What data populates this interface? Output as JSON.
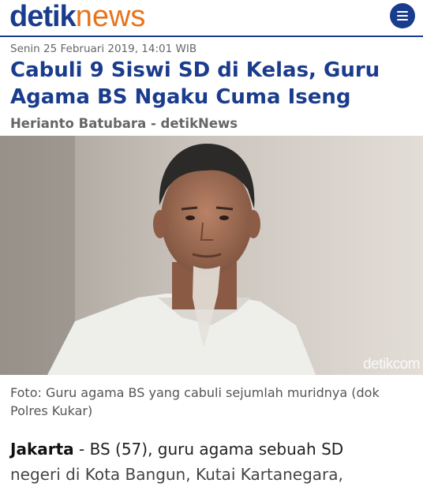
{
  "header": {
    "logo_part1": "detik",
    "logo_part2": "news",
    "menu_icon": "hamburger-menu-icon"
  },
  "article": {
    "date": "Senin 25 Februari 2019, 14:01 WIB",
    "title": "Cabuli 9 Siswi SD di Kelas, Guru Agama BS Ngaku Cuma Iseng",
    "author": "Herianto Batubara - detikNews",
    "photo_watermark": "detikcom",
    "caption": "Foto: Guru agama BS yang cabuli sejumlah muridnya (dok Polres Kukar)",
    "lead_location": "Jakarta",
    "lead_text": " - BS (57), guru agama sebuah SD",
    "lead_text_line2": "negeri di Kota Bangun, Kutai Kartanegara,"
  },
  "colors": {
    "brand_blue": "#1a3c8c",
    "brand_orange": "#e8731a"
  }
}
